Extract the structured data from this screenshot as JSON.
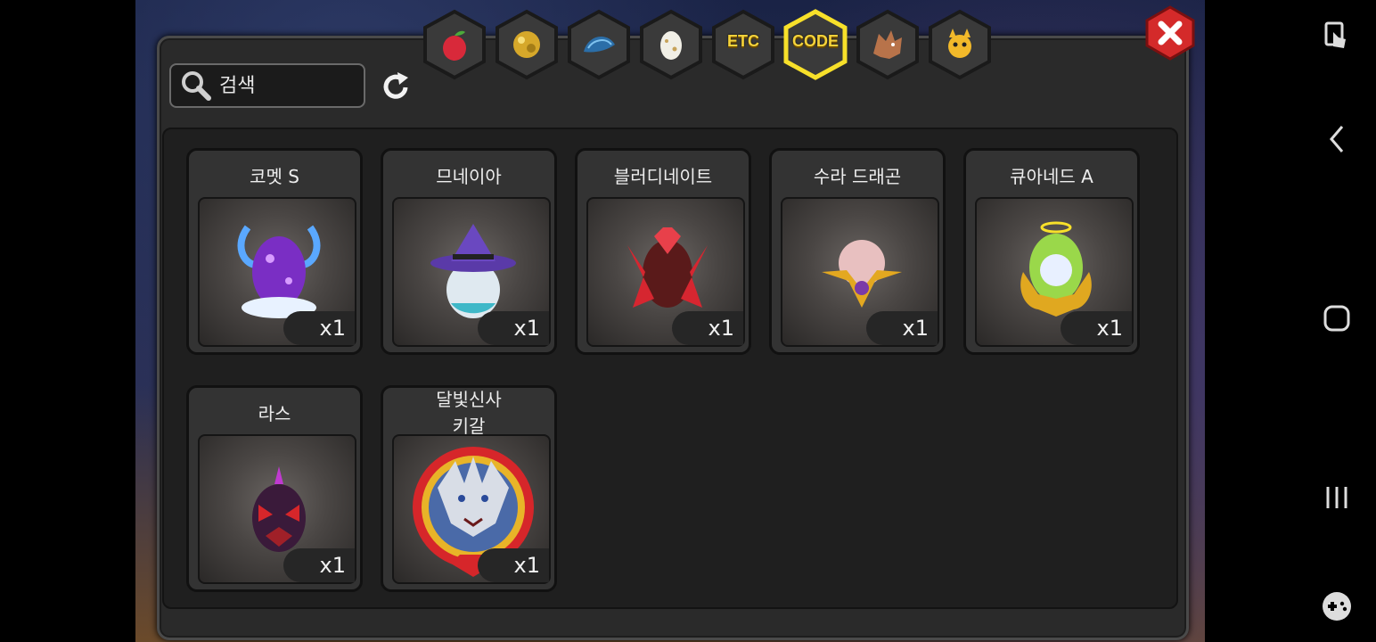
{
  "search": {
    "placeholder": "검색"
  },
  "tabs": [
    {
      "name": "fruit",
      "label": "",
      "icon": "red-fruit-icon",
      "selected": false
    },
    {
      "name": "gold",
      "label": "",
      "icon": "gold-ore-icon",
      "selected": false
    },
    {
      "name": "scale",
      "label": "",
      "icon": "blue-scale-icon",
      "selected": false
    },
    {
      "name": "egg",
      "label": "",
      "icon": "egg-icon",
      "selected": false
    },
    {
      "name": "etc",
      "label": "ETC",
      "icon": "",
      "selected": false
    },
    {
      "name": "code",
      "label": "CODE",
      "icon": "",
      "selected": true
    },
    {
      "name": "dragon",
      "label": "",
      "icon": "dragon-head-icon",
      "selected": false
    },
    {
      "name": "monster",
      "label": "",
      "icon": "yellow-monster-icon",
      "selected": false
    }
  ],
  "items": [
    {
      "name": "코멧 S",
      "qty": "x1",
      "icon": "purple-horned-egg"
    },
    {
      "name": "므네이아",
      "qty": "x1",
      "icon": "witch-hat-egg"
    },
    {
      "name": "블러디네이트",
      "qty": "x1",
      "icon": "red-blade-egg"
    },
    {
      "name": "수라 드래곤",
      "qty": "x1",
      "icon": "gold-orb-egg"
    },
    {
      "name": "큐아네드 A",
      "qty": "x1",
      "icon": "golden-angel-egg"
    },
    {
      "name": "라스",
      "qty": "x1",
      "icon": "dark-spiked-egg"
    },
    {
      "name": "달빛신사\n키갈",
      "qty": "x1",
      "icon": "wolf-portrait"
    }
  ],
  "colors": {
    "accent": "#f4d23a",
    "close": "#d42a2a",
    "panel": "#2a2a2a"
  }
}
